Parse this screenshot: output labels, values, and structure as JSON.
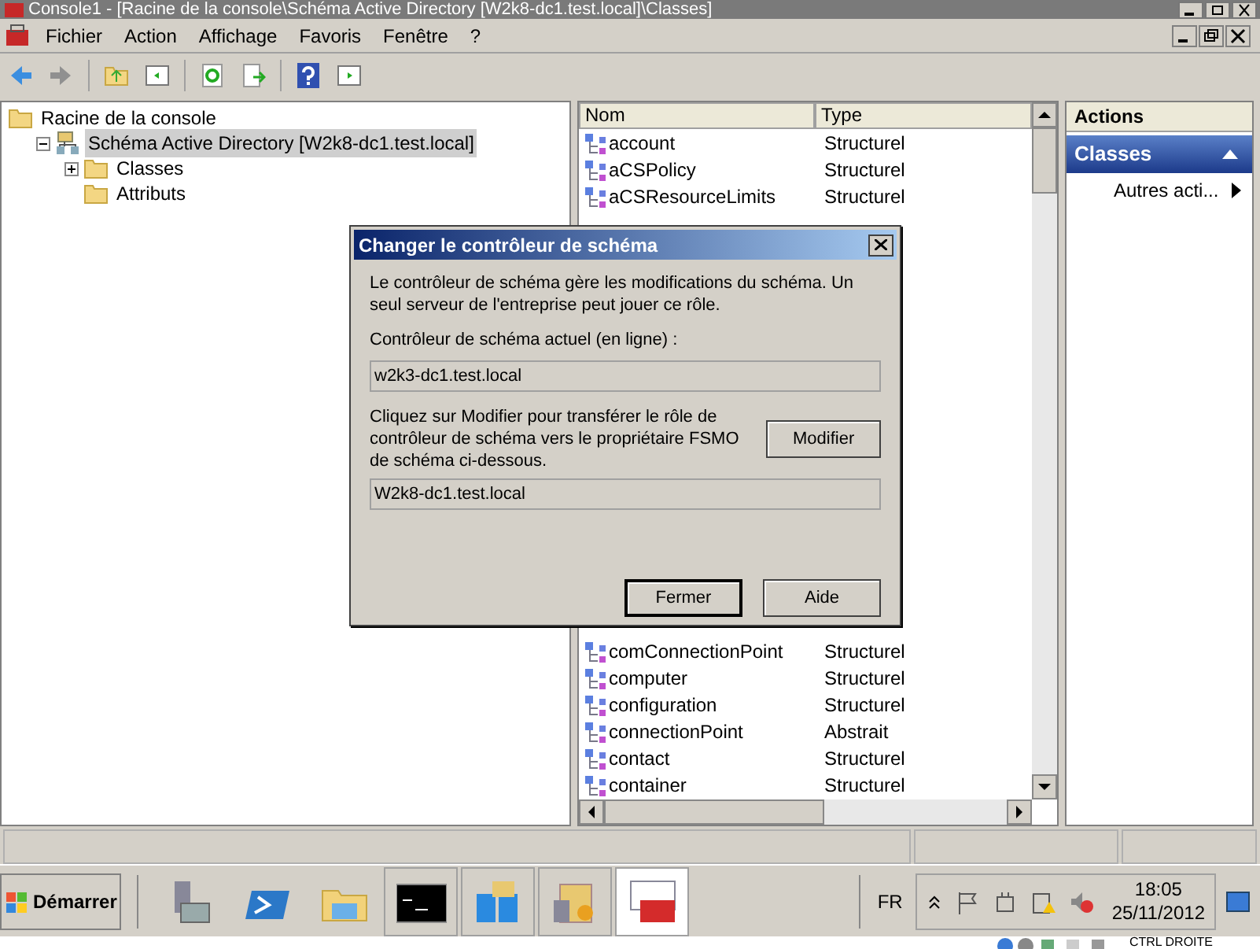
{
  "window": {
    "title": "Console1 - [Racine de la console\\Schéma Active Directory [W2k8-dc1.test.local]\\Classes]"
  },
  "menu": [
    "Fichier",
    "Action",
    "Affichage",
    "Favoris",
    "Fenêtre",
    "?"
  ],
  "tree": [
    {
      "label": "Racine de la console",
      "kind": "folder",
      "children": [
        {
          "label": "Schéma Active Directory [W2k8-dc1.test.local]",
          "kind": "schema",
          "selected": true,
          "expanded": true,
          "children": [
            {
              "label": "Classes",
              "kind": "folder",
              "selected": false,
              "expanded": false
            },
            {
              "label": "Attributs",
              "kind": "folder",
              "selected": false
            }
          ]
        }
      ]
    }
  ],
  "table": {
    "columns": [
      "Nom",
      "Type"
    ],
    "rows_above_dialog": [
      {
        "name": "account",
        "type": "Structurel"
      },
      {
        "name": "aCSPolicy",
        "type": "Structurel"
      },
      {
        "name": "aCSResourceLimits",
        "type": "Structurel"
      }
    ],
    "rows_below_dialog": [
      {
        "name": "comConnectionPoint",
        "type": "Structurel"
      },
      {
        "name": "computer",
        "type": "Structurel"
      },
      {
        "name": "configuration",
        "type": "Structurel"
      },
      {
        "name": "connectionPoint",
        "type": "Abstrait"
      },
      {
        "name": "contact",
        "type": "Structurel"
      },
      {
        "name": "container",
        "type": "Structurel"
      }
    ]
  },
  "actions": {
    "title": "Actions",
    "section": "Classes",
    "items": [
      "Autres acti..."
    ]
  },
  "dialog": {
    "title": "Changer le contrôleur de schéma",
    "intro": "Le contrôleur de schéma gère les modifications du schéma. Un seul serveur de l'entreprise peut jouer ce rôle.",
    "current_label": "Contrôleur de schéma actuel (en ligne) :",
    "current_value": "w2k3-dc1.test.local",
    "transfer_text": "Cliquez sur Modifier pour transférer le rôle de contrôleur de schéma vers le propriétaire FSMO de schéma ci-dessous.",
    "modify_button": "Modifier",
    "target_value": "W2k8-dc1.test.local",
    "buttons": [
      "Fermer",
      "Aide"
    ]
  },
  "taskbar": {
    "start": "Démarrer",
    "language": "FR",
    "time": "18:05",
    "date": "25/11/2012"
  },
  "host_status": "CTRL DROITE"
}
